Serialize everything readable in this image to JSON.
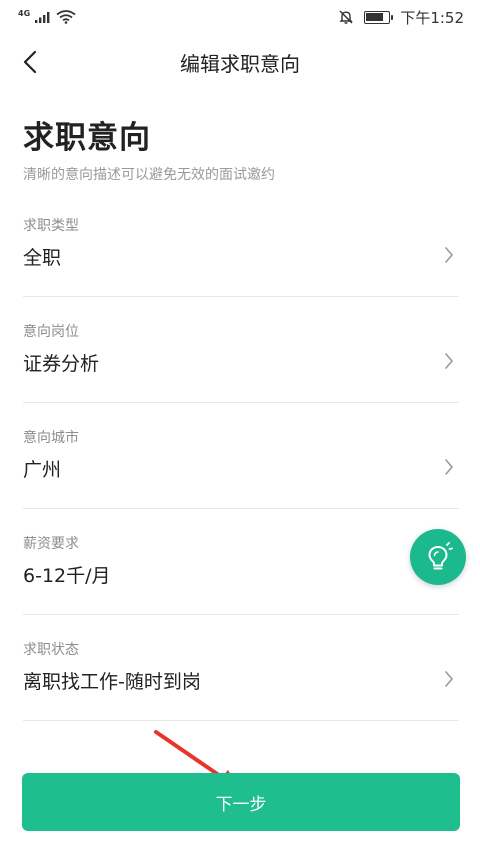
{
  "status_bar": {
    "network": "4G",
    "time": "下午1:52",
    "battery_level": 0.85
  },
  "header": {
    "title": "编辑求职意向"
  },
  "main": {
    "title": "求职意向",
    "subtitle": "清晰的意向描述可以避免无效的面试邀约",
    "fields": [
      {
        "label": "求职类型",
        "value": "全职"
      },
      {
        "label": "意向岗位",
        "value": "证券分析"
      },
      {
        "label": "意向城市",
        "value": "广州"
      },
      {
        "label": "薪资要求",
        "value": "6-12千/月"
      },
      {
        "label": "求职状态",
        "value": "离职找工作-随时到岗"
      }
    ]
  },
  "footer": {
    "next_label": "下一步"
  },
  "colors": {
    "accent": "#1fbe8f",
    "annotation_arrow": "#e8342a"
  }
}
